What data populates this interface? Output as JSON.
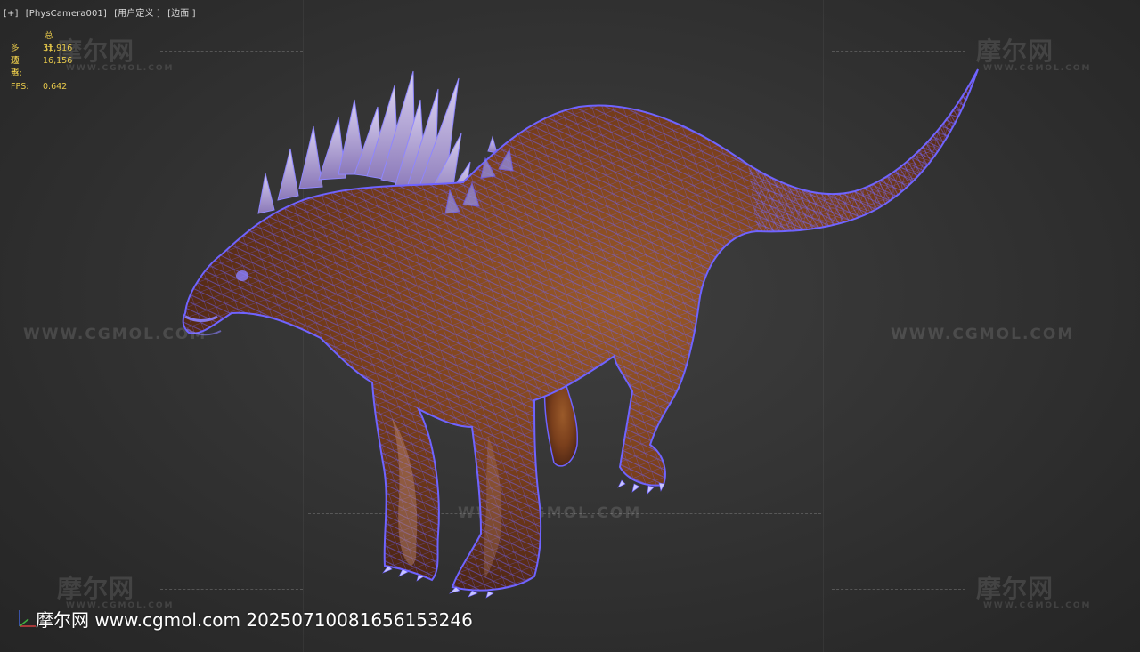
{
  "viewport": {
    "label_plus": "[+]",
    "label_camera": "[PhysCamera001]",
    "label_mode": "[用户定义 ]",
    "label_shading": "[边面 ]"
  },
  "stats": {
    "header": "总计",
    "polygons_label": "多边形:",
    "polygons_value": "31,916",
    "vertices_label": "顶点:",
    "vertices_value": "16,156",
    "fps_label": "FPS:",
    "fps_value": "0.642"
  },
  "watermarks": {
    "logo": "摩尔网",
    "logo_sub": "WWW.CGMOL.COM",
    "url": "WWW.CGMOL.COM"
  },
  "footer": {
    "text": "摩尔网 www.cgmol.com 2025071008165615324​6"
  },
  "colors": {
    "background": "#333333",
    "wireframe": "#6f63ff",
    "skin": "#8a4a22",
    "stats_text": "#e6c84a"
  },
  "icons": {
    "axis_gizmo": "axis-gizmo-icon"
  }
}
